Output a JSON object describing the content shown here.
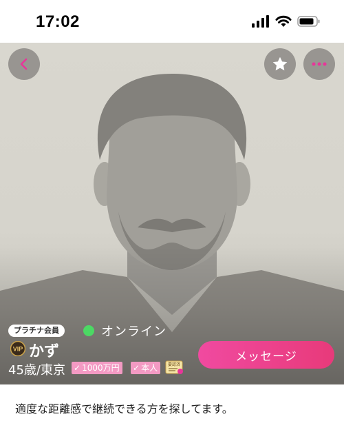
{
  "status_bar": {
    "time": "17:02",
    "icons": [
      "signal-icon",
      "wifi-icon",
      "battery-icon"
    ]
  },
  "header": {
    "back_icon": "chevron-left-icon",
    "favorite_icon": "star-icon",
    "more_icon": "ellipsis-icon"
  },
  "profile": {
    "plan": "プラチナ会員",
    "online_status": "オンライン",
    "vip_label": "VIP",
    "name": "かず",
    "age_location": "45歳/東京",
    "tags": [
      {
        "label": "1000万円"
      },
      {
        "label": "本人"
      }
    ],
    "document_icon_text": "要認済",
    "message_button": "メッセージ",
    "bio": "適度な距離感で継続できる方を探してます。"
  },
  "colors": {
    "accent": "#e83a7a",
    "tag_pink": "#f39ac3",
    "online_green": "#4cd964",
    "icon_magenta": "#e8359a"
  }
}
